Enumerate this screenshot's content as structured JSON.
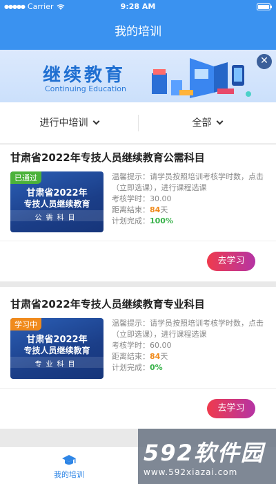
{
  "status_bar": {
    "carrier": "Carrier",
    "time": "9:28 AM"
  },
  "header": {
    "title": "我的培训"
  },
  "banner": {
    "title": "继续教育",
    "subtitle": "Continuing Education"
  },
  "filters": {
    "status": "进行中培训",
    "category": "全部"
  },
  "courses": [
    {
      "title": "甘肃省2022年专技人员继续教育公需科目",
      "cover": {
        "line1": "甘肃省2022年",
        "line2": "专技人员继续教育",
        "line3": "公需科目"
      },
      "tag": "已通过",
      "tip": "温馨提示：请学员按照培训考核学时数，点击（立即选课），进行课程选课",
      "hours_label": "考核学时：",
      "hours": "30.00",
      "deadline_label": "距离结束：",
      "deadline_days": "84",
      "deadline_unit": "天",
      "progress_label": "计划完成：",
      "progress": "100%",
      "button": "去学习"
    },
    {
      "title": "甘肃省2022年专技人员继续教育专业科目",
      "cover": {
        "line1": "甘肃省2022年",
        "line2": "专技人员继续教育",
        "line3": "专业科目"
      },
      "tag": "学习中",
      "tip": "温馨提示：请学员按照培训考核学时数，点击（立即选课），进行课程选课",
      "hours_label": "考核学时：",
      "hours": "60.00",
      "deadline_label": "距离结束：",
      "deadline_days": "84",
      "deadline_unit": "天",
      "progress_label": "计划完成：",
      "progress": "0%",
      "button": "去学习"
    }
  ],
  "tabbar": {
    "tab_label": "我的培训"
  },
  "watermark": {
    "brand": "592软件园",
    "url": "www.592xiazai.com"
  },
  "colors": {
    "primary": "#3a92f0",
    "orange": "#f08a1c",
    "green": "#38b24a",
    "button_start": "#ef3b4d",
    "button_end": "#b534a4"
  }
}
